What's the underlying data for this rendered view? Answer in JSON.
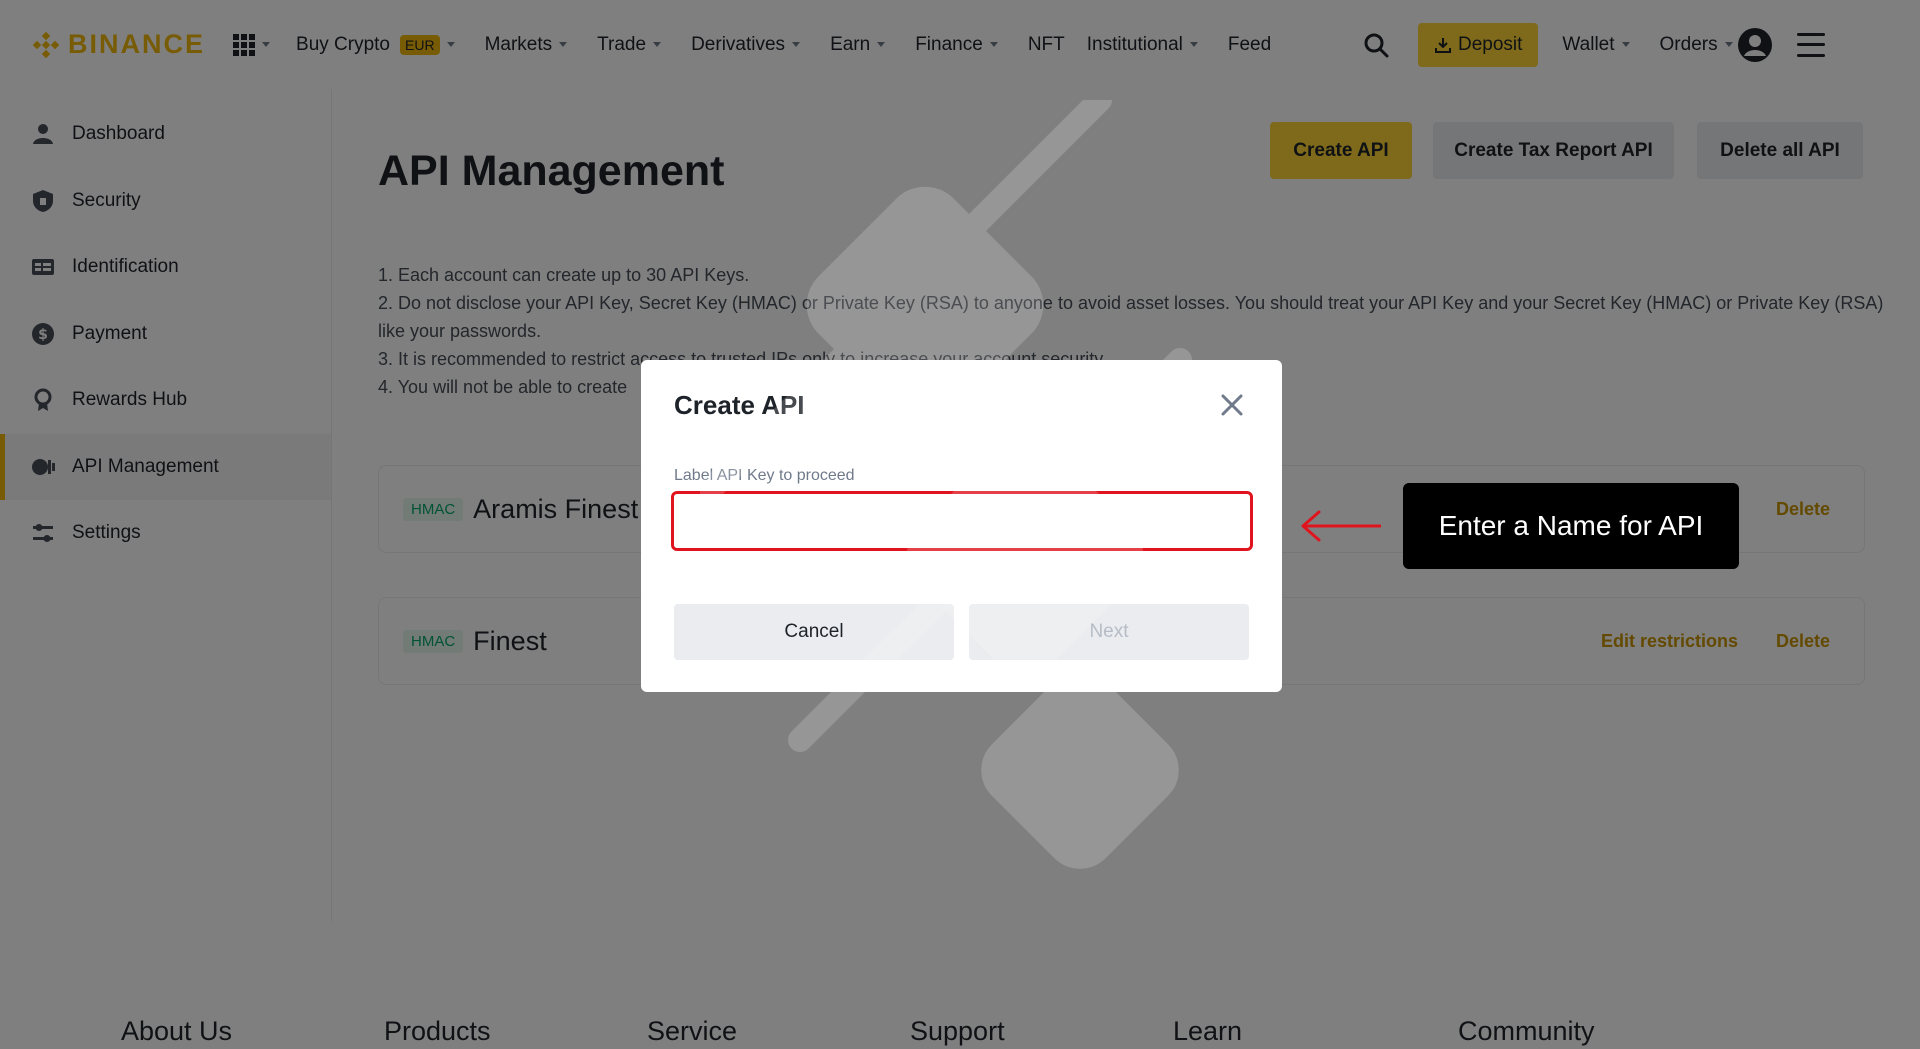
{
  "brand": {
    "name": "BINANCE",
    "color": "#f0b90b"
  },
  "nav": {
    "items": [
      {
        "label": "Buy Crypto",
        "badge": "EUR",
        "caret": true
      },
      {
        "label": "Markets",
        "caret": true
      },
      {
        "label": "Trade",
        "caret": true
      },
      {
        "label": "Derivatives",
        "caret": true
      },
      {
        "label": "Earn",
        "caret": true
      },
      {
        "label": "Finance",
        "caret": true
      },
      {
        "label": "NFT",
        "caret": false
      },
      {
        "label": "Institutional",
        "caret": true
      },
      {
        "label": "Feed",
        "caret": false
      }
    ],
    "deposit_label": "Deposit",
    "wallet_label": "Wallet",
    "orders_label": "Orders"
  },
  "sidebar": {
    "items": [
      {
        "label": "Dashboard",
        "icon": "user-icon"
      },
      {
        "label": "Security",
        "icon": "shield-icon"
      },
      {
        "label": "Identification",
        "icon": "id-card-icon"
      },
      {
        "label": "Payment",
        "icon": "dollar-coin-icon"
      },
      {
        "label": "Rewards Hub",
        "icon": "medal-icon"
      },
      {
        "label": "API Management",
        "icon": "api-icon",
        "active": true
      },
      {
        "label": "Settings",
        "icon": "sliders-icon"
      }
    ]
  },
  "main": {
    "title": "API Management",
    "buttons": {
      "create_api": "Create API",
      "create_tax": "Create Tax Report API",
      "delete_all": "Delete all API"
    },
    "notes": [
      "1. Each account can create up to 30 API Keys.",
      "2. Do not disclose your API Key, Secret Key (HMAC) or Private Key (RSA) to anyone to avoid asset losses. You should treat your API Key and your Secret Key (HMAC) or Private Key (RSA) like your passwords.",
      "3. It is recommended to restrict access to trusted IPs only to increase your account security.",
      "4. You will not be able to create"
    ],
    "api_keys": [
      {
        "type": "HMAC",
        "name": "Aramis Finest",
        "delete_label": "Delete"
      },
      {
        "type": "HMAC",
        "name": "Finest",
        "edit_label": "Edit restrictions",
        "delete_label": "Delete"
      }
    ]
  },
  "footer": {
    "links": [
      "About Us",
      "Products",
      "Service",
      "Support",
      "Learn",
      "Community"
    ]
  },
  "modal": {
    "title": "Create API",
    "field_label": "Label API Key to proceed",
    "input_value": "",
    "cancel_label": "Cancel",
    "next_label": "Next"
  },
  "annotation": {
    "callout_text": "Enter a Name for API",
    "highlight_color": "#e0141e"
  }
}
